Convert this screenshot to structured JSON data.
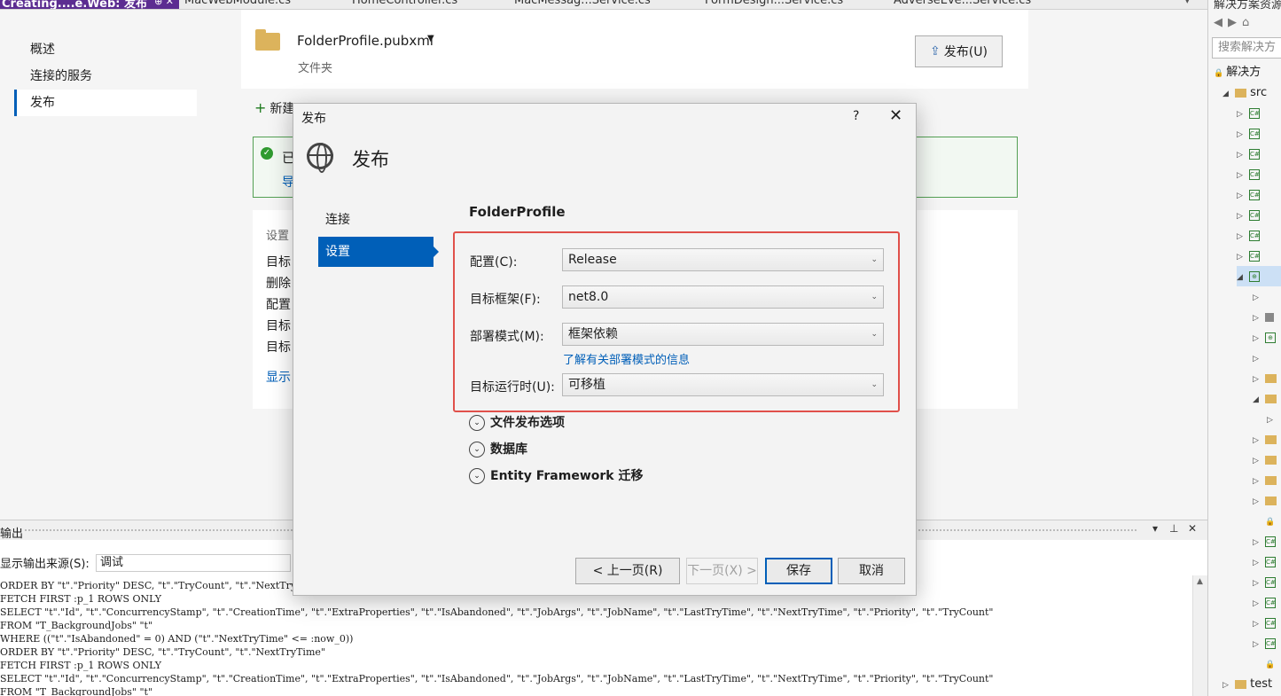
{
  "tabs": [
    {
      "label": "Creating....e.Web: 发布",
      "active": true
    },
    {
      "label": "MacWebModule.cs"
    },
    {
      "label": "HomeController.cs"
    },
    {
      "label": "MacMessag...Service.cs"
    },
    {
      "label": "FormDesign...Service.cs"
    },
    {
      "label": "AdverseEve...Service.cs"
    }
  ],
  "tab_controls": "⊕ ✕",
  "left_nav": {
    "items": [
      {
        "label": "概述"
      },
      {
        "label": "连接的服务"
      },
      {
        "label": "发布",
        "active": true
      }
    ]
  },
  "profile": {
    "name": "FolderProfile.pubxml",
    "subtitle": "文件夹",
    "publish_button": "发布(U)",
    "new_link": "新建"
  },
  "success": {
    "line1": "已",
    "line2": "导"
  },
  "settings_card": {
    "header": "设置",
    "rows": [
      "目标",
      "删除",
      "配置",
      "目标",
      "目标"
    ],
    "show_link": "显示"
  },
  "output": {
    "title": "输出",
    "source_label": "显示输出来源(S):",
    "source_value": "调试",
    "lines": [
      "ORDER BY \"t\".\"Priority\" DESC, \"t\".\"TryCount\", \"t\".\"NextTryTime\"",
      "FETCH FIRST :p_1 ROWS ONLY",
      "SELECT \"t\".\"Id\", \"t\".\"ConcurrencyStamp\", \"t\".\"CreationTime\", \"t\".\"ExtraProperties\", \"t\".\"IsAbandoned\", \"t\".\"JobArgs\", \"t\".\"JobName\", \"t\".\"LastTryTime\", \"t\".\"NextTryTime\", \"t\".\"Priority\", \"t\".\"TryCount\"",
      "FROM \"T_BackgroundJobs\" \"t\"",
      "WHERE ((\"t\".\"IsAbandoned\" = 0) AND (\"t\".\"NextTryTime\" <= :now_0))",
      "ORDER BY \"t\".\"Priority\" DESC, \"t\".\"TryCount\", \"t\".\"NextTryTime\"",
      "FETCH FIRST :p_1 ROWS ONLY",
      "SELECT \"t\".\"Id\", \"t\".\"ConcurrencyStamp\", \"t\".\"CreationTime\", \"t\".\"ExtraProperties\", \"t\".\"IsAbandoned\", \"t\".\"JobArgs\", \"t\".\"JobName\", \"t\".\"LastTryTime\", \"t\".\"NextTryTime\", \"t\".\"Priority\", \"t\".\"TryCount\"",
      "FROM \"T_BackgroundJobs\" \"t\""
    ]
  },
  "solution_explorer": {
    "title": "解决方案资源",
    "search_placeholder": "搜索解决方",
    "solution_label": "解决方",
    "src_label": "src",
    "test_label": "test"
  },
  "dialog": {
    "title": "发布",
    "help": "?",
    "close": "✕",
    "heading": "发布",
    "nav": [
      {
        "label": "连接"
      },
      {
        "label": "设置",
        "active": true
      }
    ],
    "profile_title": "FolderProfile",
    "fields": [
      {
        "label": "配置(C):",
        "value": "Release"
      },
      {
        "label": "目标框架(F):",
        "value": "net8.0"
      },
      {
        "label": "部署模式(M):",
        "value": "框架依赖"
      },
      {
        "label": "目标运行时(U):",
        "value": "可移植"
      }
    ],
    "deploy_link": "了解有关部署模式的信息",
    "expanders": [
      {
        "label": "文件发布选项"
      },
      {
        "label": "数据库"
      },
      {
        "label": "Entity Framework 迁移"
      }
    ],
    "buttons": {
      "prev": "< 上一页(R)",
      "next": "下一页(X) >",
      "save": "保存",
      "cancel": "取消"
    }
  },
  "colors": {
    "accent": "#005fb8",
    "highlight_box": "#e0504a",
    "vs_purple": "#5c2d91"
  }
}
